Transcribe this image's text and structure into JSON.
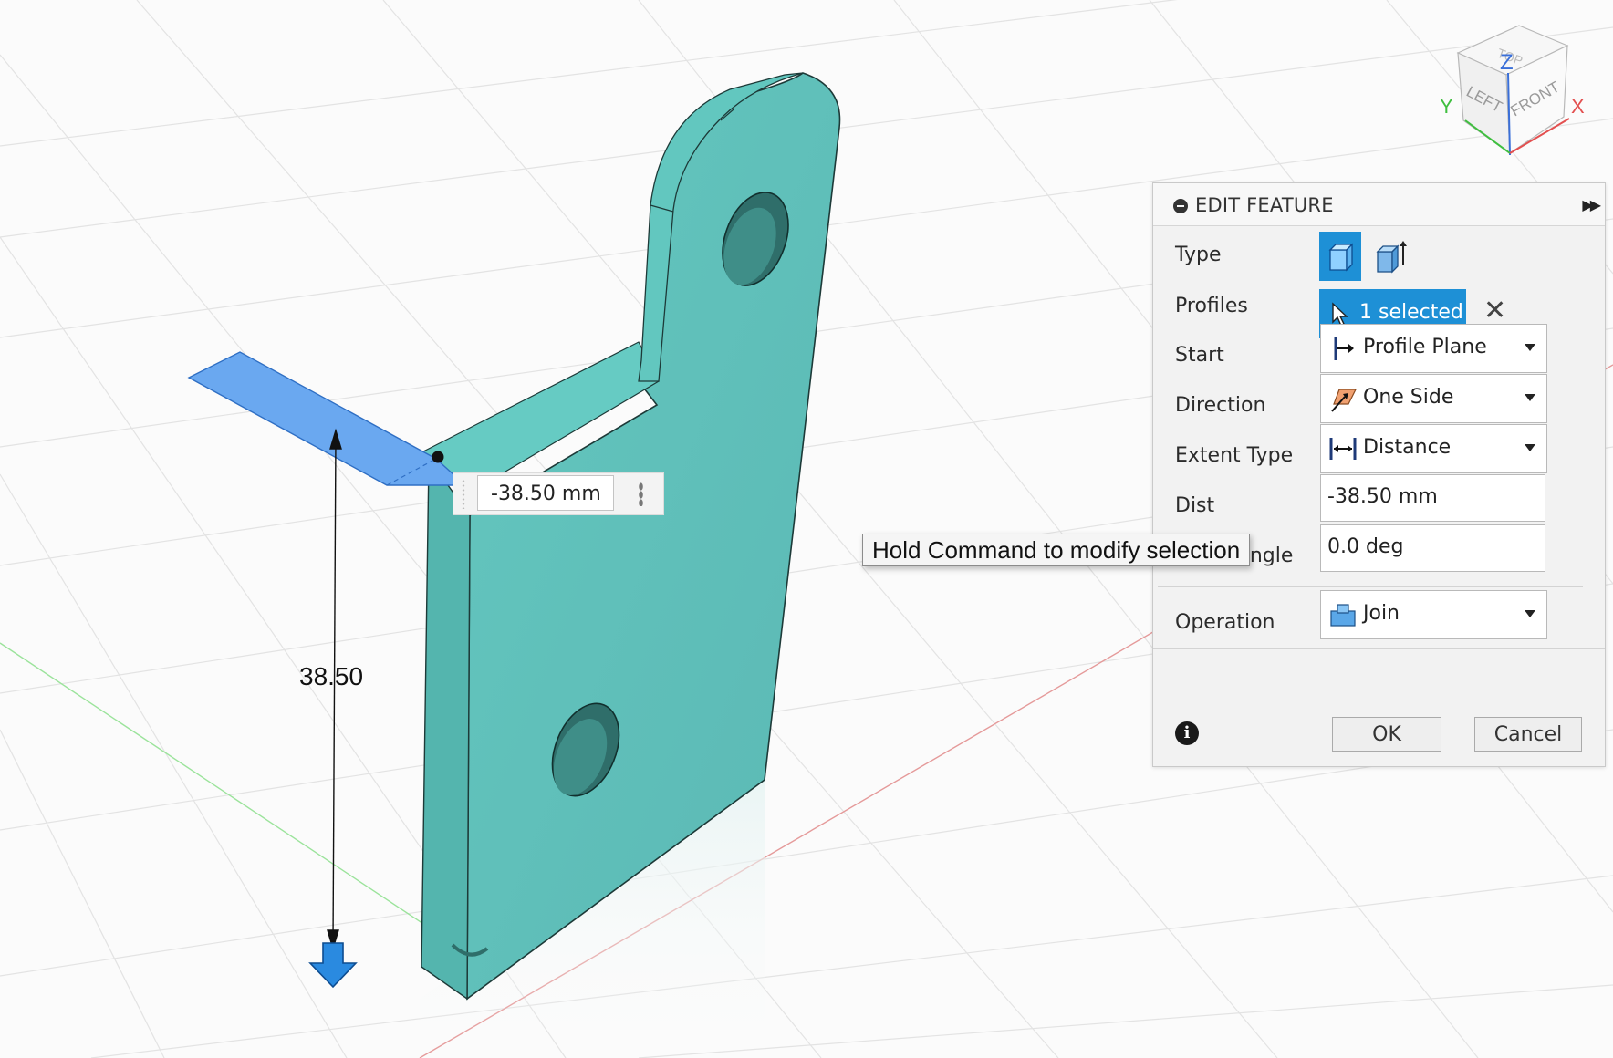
{
  "panel": {
    "title": "EDIT FEATURE",
    "rows": {
      "type": "Type",
      "profiles": "Profiles",
      "start": "Start",
      "direction": "Direction",
      "extent_type": "Extent Type",
      "distance": "Dist",
      "taper_angle": "Taper Angle",
      "operation": "Operation"
    },
    "profiles_value": "1 selected",
    "start_value": "Profile Plane",
    "direction_value": "One Side",
    "extent_type_value": "Distance",
    "distance_value": "-38.50 mm",
    "taper_value": "0.0 deg",
    "operation_value": "Join",
    "ok_label": "OK",
    "cancel_label": "Cancel"
  },
  "tooltip": "Hold Command to modify selection",
  "canvas": {
    "distance_input": "-38.50 mm",
    "dimension_label": "38.50"
  },
  "viewcube": {
    "faces": [
      "TOP",
      "LEFT",
      "FRONT"
    ],
    "axes": [
      "Z",
      "Y",
      "X"
    ]
  },
  "colors": {
    "accent": "#1e90d6",
    "part": "#5fbfb8",
    "profile": "#6aa8f0"
  }
}
